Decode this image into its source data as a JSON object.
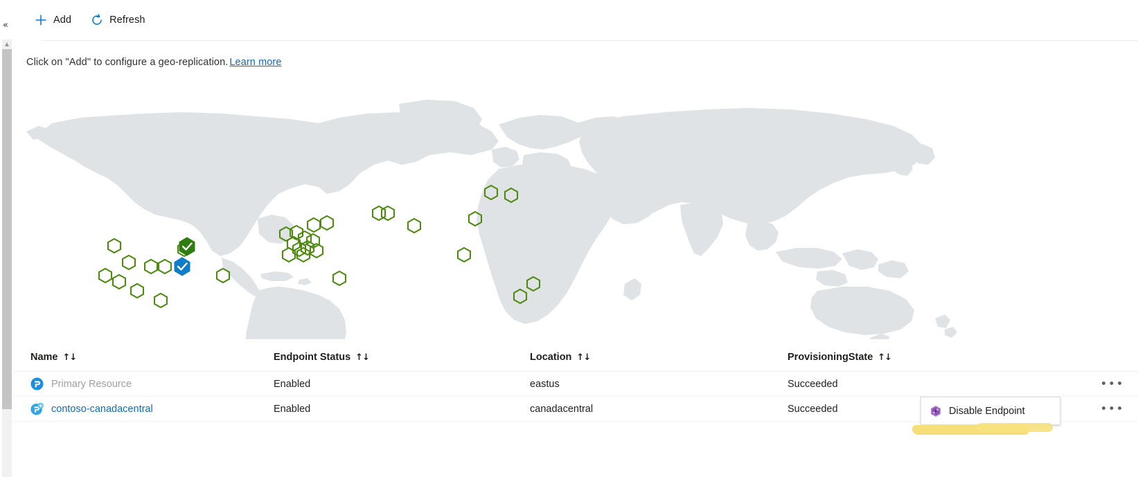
{
  "left_rail": {
    "collapse_icon": "chevron-double-left",
    "scroll_up_icon": "caret-up"
  },
  "command_bar": {
    "buttons": [
      {
        "label": "Add",
        "icon": "plus-icon"
      },
      {
        "label": "Refresh",
        "icon": "refresh-icon"
      }
    ]
  },
  "info": {
    "text": "Click on \"Add\" to configure a geo-replication.",
    "link_label": "Learn more"
  },
  "map": {
    "alt": "world-map-geo-replication",
    "land_color": "#dfe3e6",
    "marker_outline_color": "#4f8a10",
    "marker_primary_color": "#2f7d0f",
    "marker_selected_color": "#0f7ec8",
    "marker_counts": {
      "outline_hexagons": 33,
      "filled_green": 1,
      "filled_blue": 1
    }
  },
  "table": {
    "columns": [
      {
        "label": "Name",
        "sort": "↑↓"
      },
      {
        "label": "Endpoint Status",
        "sort": "↑↓"
      },
      {
        "label": "Location",
        "sort": "↑↓"
      },
      {
        "label": "ProvisioningState",
        "sort": "↑↓"
      }
    ],
    "rows": [
      {
        "name": "Primary Resource",
        "name_style": "muted",
        "icon": "primary-resource-icon",
        "endpoint_status": "Enabled",
        "location": "eastus",
        "provisioning_state": "Succeeded",
        "menu": "•••"
      },
      {
        "name": "contoso-canadacentral",
        "name_style": "link",
        "icon": "replica-resource-icon",
        "endpoint_status": "Enabled",
        "location": "canadacentral",
        "provisioning_state": "Succeeded",
        "menu": "•••"
      }
    ]
  },
  "context_menu": {
    "items": [
      {
        "label": "Disable Endpoint",
        "icon": "disable-endpoint-icon"
      }
    ]
  },
  "annotation": {
    "highlight_color": "#f5dd72",
    "shape": "marker-stroke"
  },
  "colors": {
    "accent": "#0078d4",
    "link": "#0f6cbd",
    "text": "#201f1e",
    "muted": "#a19f9d",
    "border": "#edebe9"
  }
}
